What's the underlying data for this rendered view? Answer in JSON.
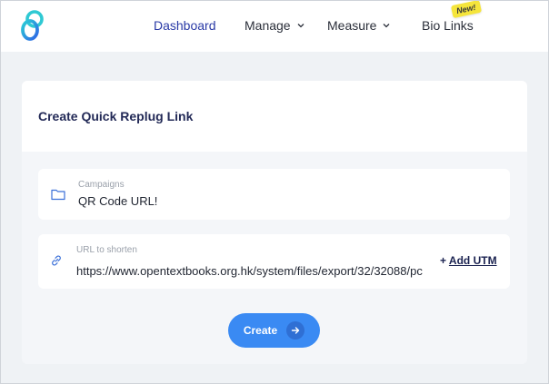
{
  "nav": {
    "items": [
      {
        "label": "Dashboard"
      },
      {
        "label": "Manage"
      },
      {
        "label": "Measure"
      },
      {
        "label": "Bio Links"
      }
    ],
    "badge": "New!"
  },
  "card": {
    "title": "Create Quick Replug Link"
  },
  "campaign": {
    "label": "Campaigns",
    "value": "QR Code URL!"
  },
  "url": {
    "label": "URL to shorten",
    "value": "https://www.opentextbooks.org.hk/system/files/export/32/32088/pc",
    "add_utm_prefix": "+",
    "add_utm_label": "Add UTM"
  },
  "create": {
    "label": "Create"
  },
  "colors": {
    "accent": "#3a8af3",
    "nav_active": "#2a3aa6",
    "title": "#232a57",
    "badge": "#f5e53b"
  },
  "icons": {
    "logo": "replug-logo-icon",
    "campaign": "folder-icon",
    "url": "link-icon",
    "create": "arrow-right-icon",
    "dropdown": "chevron-down-icon"
  }
}
